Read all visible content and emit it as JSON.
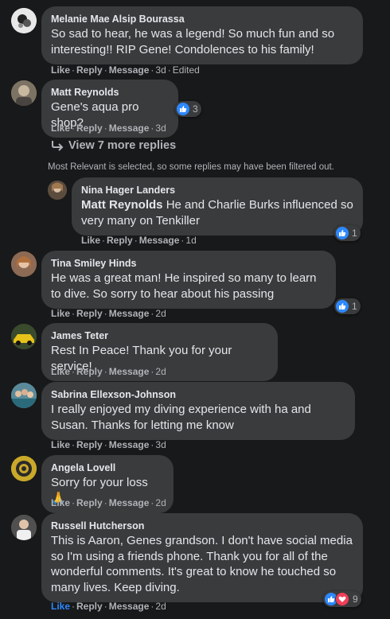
{
  "actions": {
    "like": "Like",
    "reply": "Reply",
    "message": "Message",
    "edited": "Edited"
  },
  "view_more_replies": "View 7 more replies",
  "filter_note": "Most Relevant is selected, so some replies may have been filtered out.",
  "comments": [
    {
      "author": "Melanie Mae Alsip Bourassa",
      "text": "So sad to hear, he was a legend! So much fun and so interesting!! RIP Gene! Condolences to his family!",
      "time": "3d"
    },
    {
      "author": "Matt Reynolds",
      "text": "Gene's aqua pro shop?",
      "time": "3d",
      "reactions": "3"
    },
    {
      "author": "Nina Hager Landers",
      "mention": "Matt Reynolds",
      "text": "He and Charlie Burks influenced so very many on Tenkiller",
      "time": "1d",
      "reactions": "1"
    },
    {
      "author": "Tina Smiley Hinds",
      "text": "He was a great man! He inspired so many to learn to dive. So sorry to hear about his passing",
      "time": "2d",
      "reactions": "1"
    },
    {
      "author": "James Teter",
      "text": "Rest In Peace! Thank you for your service!",
      "time": "2d"
    },
    {
      "author": "Sabrina Ellexson-Johnson",
      "text": "I really enjoyed my diving experience with ha and Susan. Thanks for letting me know",
      "time": "3d"
    },
    {
      "author": "Angela Lovell",
      "text": "Sorry for your loss 🙏",
      "time": "2d"
    },
    {
      "author": "Russell Hutcherson",
      "text": "This is Aaron, Genes grandson. I don't have social media so I'm using a friends phone. Thank you for all of the wonderful comments. It's great to know he touched so many lives. Keep diving.",
      "time": "2d",
      "reactions": "9"
    }
  ],
  "colors": {
    "background": "#18191a",
    "bubble": "#3a3b3c",
    "like_blue": "#2d88ff",
    "love_red": "#f33e58",
    "secondary_text": "#b0b3b8"
  }
}
